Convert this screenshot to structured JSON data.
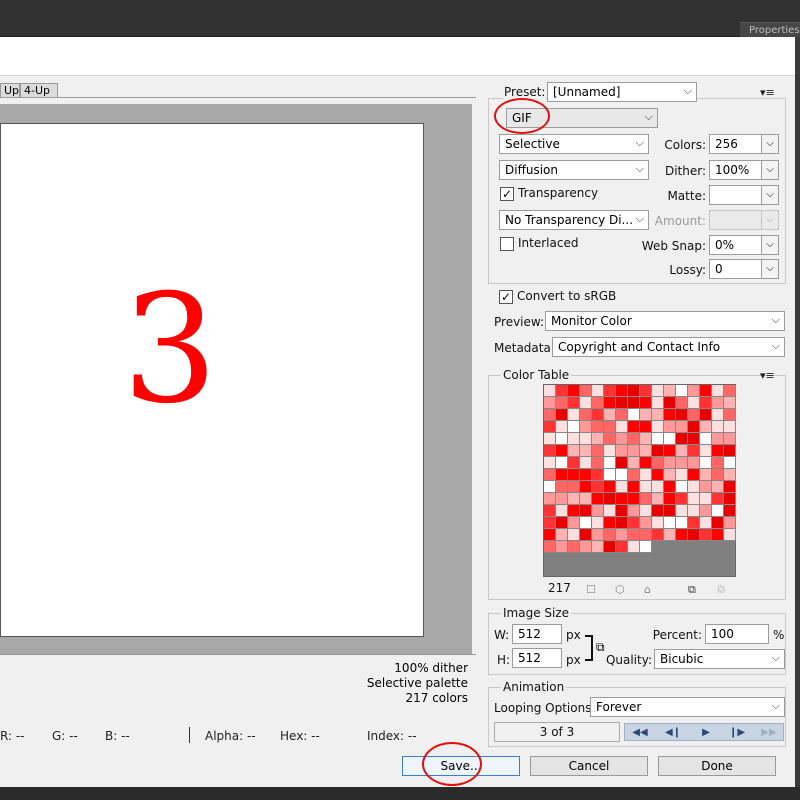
{
  "app": {
    "properties_tab": "Properties"
  },
  "views": {
    "tabs": [
      "Up",
      "4-Up"
    ]
  },
  "canvas": {
    "digit": "3",
    "info": {
      "dither": "100% dither",
      "palette": "Selective palette",
      "colors": "217 colors"
    }
  },
  "status": {
    "r": "R: --",
    "g": "G: --",
    "b": "B: --",
    "alpha": "Alpha: --",
    "hex": "Hex: --",
    "index": "Index: --"
  },
  "settings": {
    "preset_label": "Preset:",
    "preset_value": "[Unnamed]",
    "format_value": "GIF",
    "reduction_value": "Selective",
    "dither_algo_value": "Diffusion",
    "transparency_label": "Transparency",
    "transparency_checked": true,
    "transparency_dither_value": "No Transparency Di...",
    "interlaced_label": "Interlaced",
    "interlaced_checked": false,
    "colors_label": "Colors:",
    "colors_value": "256",
    "dither_label": "Dither:",
    "dither_value": "100%",
    "matte_label": "Matte:",
    "matte_value": "",
    "amount_label": "Amount:",
    "amount_value": "",
    "websnap_label": "Web Snap:",
    "websnap_value": "0%",
    "lossy_label": "Lossy:",
    "lossy_value": "0",
    "convert_label": "Convert to sRGB",
    "convert_checked": true,
    "preview_label": "Preview:",
    "preview_value": "Monitor Color",
    "metadata_label": "Metadata:",
    "metadata_value": "Copyright and Contact Info"
  },
  "color_table": {
    "title": "Color Table",
    "count": "217",
    "colors": [
      "#ff0000",
      "#ff6666",
      "#ffb3b3",
      "#ffe0e0",
      "#ff3333",
      "#ff9999",
      "#ffffff",
      "#e60000"
    ],
    "selected_cell_color": "#ffffff"
  },
  "image_size": {
    "title": "Image Size",
    "w_label": "W:",
    "w_value": "512",
    "h_label": "H:",
    "h_value": "512",
    "unit": "px",
    "percent_label": "Percent:",
    "percent_value": "100",
    "percent_unit": "%",
    "quality_label": "Quality:",
    "quality_value": "Bicubic"
  },
  "animation": {
    "title": "Animation",
    "looping_label": "Looping Options:",
    "looping_value": "Forever",
    "frame_counter": "3 of 3"
  },
  "buttons": {
    "save": "Save...",
    "cancel": "Cancel",
    "done": "Done"
  },
  "accent": {
    "annotation": "#e01010",
    "digit": "#ff0000"
  }
}
